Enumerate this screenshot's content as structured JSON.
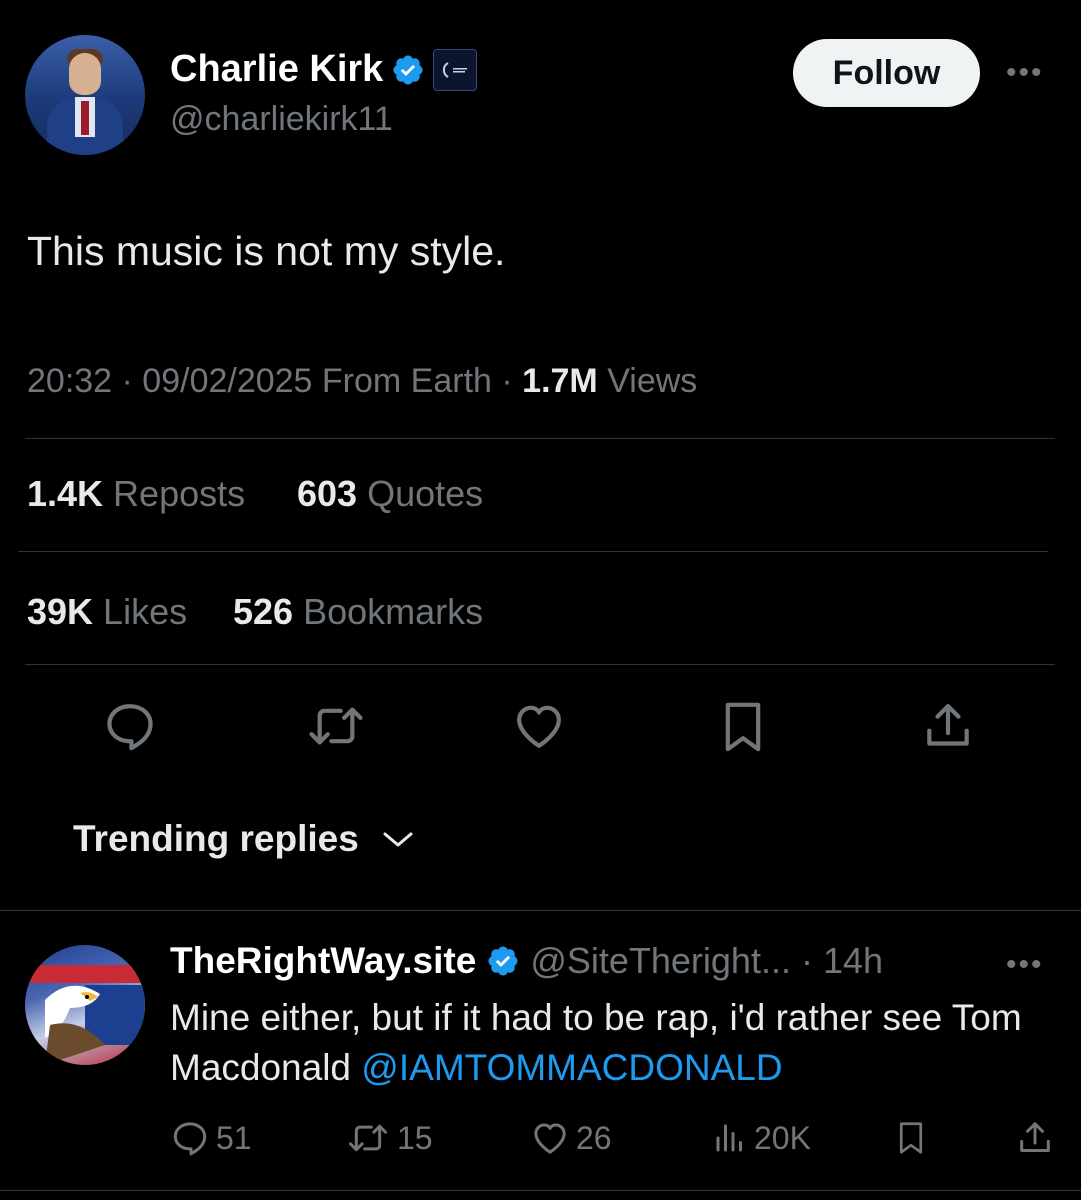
{
  "tweet": {
    "author_name": "Charlie Kirk",
    "author_handle": "@charliekirk11",
    "follow_label": "Follow",
    "more_label": "•••",
    "text": "This music is not my style.",
    "meta_time": "20:32 · 09/02/2025 From Earth · ",
    "views_count": "1.7M",
    "views_label": " Views",
    "reposts_count": "1.4K",
    "reposts_label": " Reposts",
    "quotes_count": "603",
    "quotes_label": " Quotes",
    "likes_count": "39K",
    "likes_label": " Likes",
    "bookmarks_count": "526",
    "bookmarks_label": " Bookmarks",
    "accent_color": "#1d9bf0"
  },
  "actions": {
    "icons": [
      "reply-icon",
      "retweet-icon",
      "like-icon",
      "bookmark-icon",
      "share-icon"
    ]
  },
  "trending": {
    "label": "Trending replies"
  },
  "reply": {
    "author_name": "TheRightWay.site",
    "author_handle_time": "@SiteTheright... · 14h",
    "more_label": "•••",
    "text_before": "Mine either, but if it had to be rap, i'd rather see Tom Macdonald ",
    "mention": "@IAMTOMMACDONALD",
    "replies": "51",
    "reposts": "15",
    "likes": "26",
    "views": "20K"
  }
}
